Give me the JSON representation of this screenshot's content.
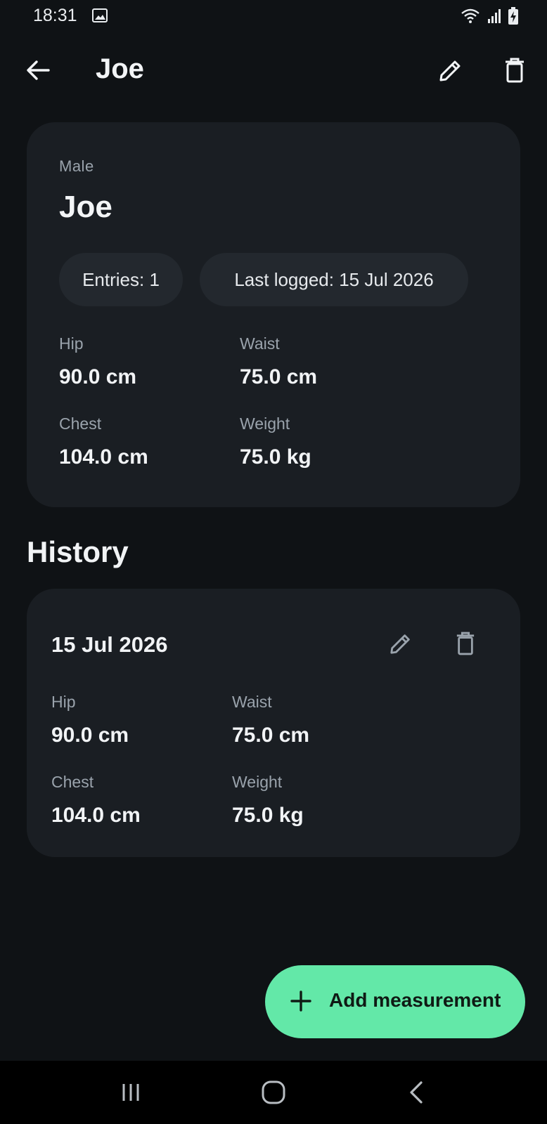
{
  "status_bar": {
    "time": "18:31",
    "icons": [
      "image-icon",
      "wifi-icon",
      "signal-icon",
      "battery-charging-icon"
    ]
  },
  "app_bar": {
    "title": "Joe",
    "icons": [
      "back-arrow-icon",
      "edit-icon",
      "delete-icon"
    ]
  },
  "summary": {
    "gender": "Male",
    "name": "Joe",
    "chips": {
      "entries": "Entries: 1",
      "last_logged": "Last logged: 15 Jul 2026"
    },
    "stats": {
      "hip_label": "Hip",
      "hip_value": "90.0 cm",
      "waist_label": "Waist",
      "waist_value": "75.0 cm",
      "chest_label": "Chest",
      "chest_value": "104.0 cm",
      "weight_label": "Weight",
      "weight_value": "75.0 kg"
    }
  },
  "history": {
    "heading": "History",
    "entries": [
      {
        "date": "15 Jul 2026",
        "hip_label": "Hip",
        "hip_value": "90.0 cm",
        "waist_label": "Waist",
        "waist_value": "75.0 cm",
        "chest_label": "Chest",
        "chest_value": "104.0 cm",
        "weight_label": "Weight",
        "weight_value": "75.0 kg"
      }
    ]
  },
  "fab": {
    "label": "Add measurement",
    "icon": "plus-icon"
  },
  "nav": {
    "icons": [
      "recents-icon",
      "home-icon",
      "back-icon"
    ]
  },
  "colors": {
    "background": "#0f1215",
    "card": "#1a1e23",
    "chip": "#23282e",
    "accent": "#63e8a8",
    "muted_text": "#9aa3ac"
  }
}
